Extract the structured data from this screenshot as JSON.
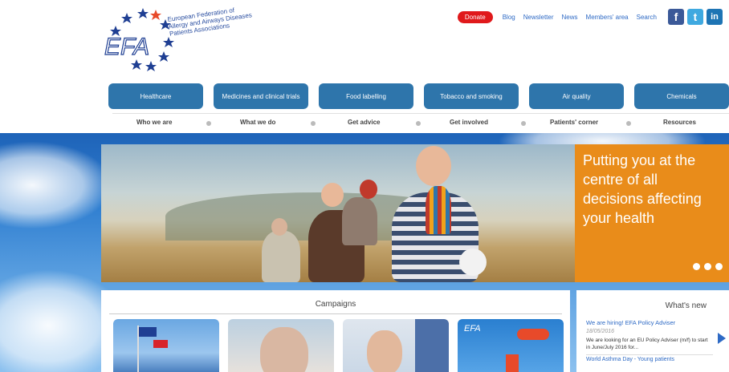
{
  "logo": {
    "letters": "EFA",
    "line1": "European Federation of",
    "line2": "Allergy and Airways Diseases",
    "line3": "Patients Associations"
  },
  "topnav": {
    "donate": "Donate",
    "links": [
      "Blog",
      "Newsletter",
      "News",
      "Members' area",
      "Search"
    ],
    "social": [
      {
        "name": "facebook-icon",
        "glyph": "f",
        "color": "#3b5998"
      },
      {
        "name": "twitter-icon",
        "glyph": "t",
        "color": "#3fa9e0"
      },
      {
        "name": "linkedin-icon",
        "glyph": "in",
        "color": "#1d74b4"
      }
    ]
  },
  "categories": [
    {
      "label": "Healthcare",
      "color": "#2aa0dc"
    },
    {
      "label": "Medicines and clinical trials",
      "color": "#79b82c"
    },
    {
      "label": "Food labelling",
      "color": "#f0a21b"
    },
    {
      "label": "Tobacco and smoking",
      "color": "#e75b28"
    },
    {
      "label": "Air quality",
      "color": "#7a64b0"
    },
    {
      "label": "Chemicals",
      "color": "#d8232a"
    }
  ],
  "mainnav": [
    "Who we are",
    "What we do",
    "Get advice",
    "Get involved",
    "Patients' corner",
    "Resources"
  ],
  "hero": {
    "tagline": "Putting you at the centre of all decisions affecting your health",
    "accent": "#e98c1a"
  },
  "campaigns": {
    "title": "Campaigns"
  },
  "whatsnew": {
    "title": "What's new",
    "item_title": "We are hiring! EFA Policy Adviser",
    "item_date": "18/05/2016",
    "item_body": "We are looking for an EU Policy Adviser (m/f) to start in June/July 2016 for...",
    "next_title": "World Asthma Day - Young patients"
  }
}
